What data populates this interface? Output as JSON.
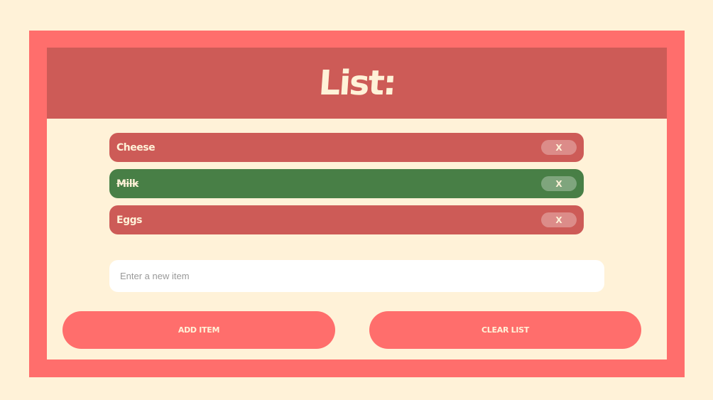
{
  "header": {
    "title": "List:"
  },
  "items": [
    {
      "label": "Cheese",
      "remove_label": "X",
      "done": false
    },
    {
      "label": "Milk",
      "remove_label": "X",
      "done": true
    },
    {
      "label": "Eggs",
      "remove_label": "X",
      "done": false
    }
  ],
  "input": {
    "value": "",
    "placeholder": "Enter a new item"
  },
  "buttons": {
    "add_label": "ADD ITEM",
    "clear_label": "CLEAR LIST"
  },
  "colors": {
    "background": "#fff2d8",
    "frame": "#ff6e6c",
    "header": "#cd5b57",
    "item_pending": "#cd5b57",
    "item_done": "#487f46",
    "text_light": "#fff2d8"
  }
}
